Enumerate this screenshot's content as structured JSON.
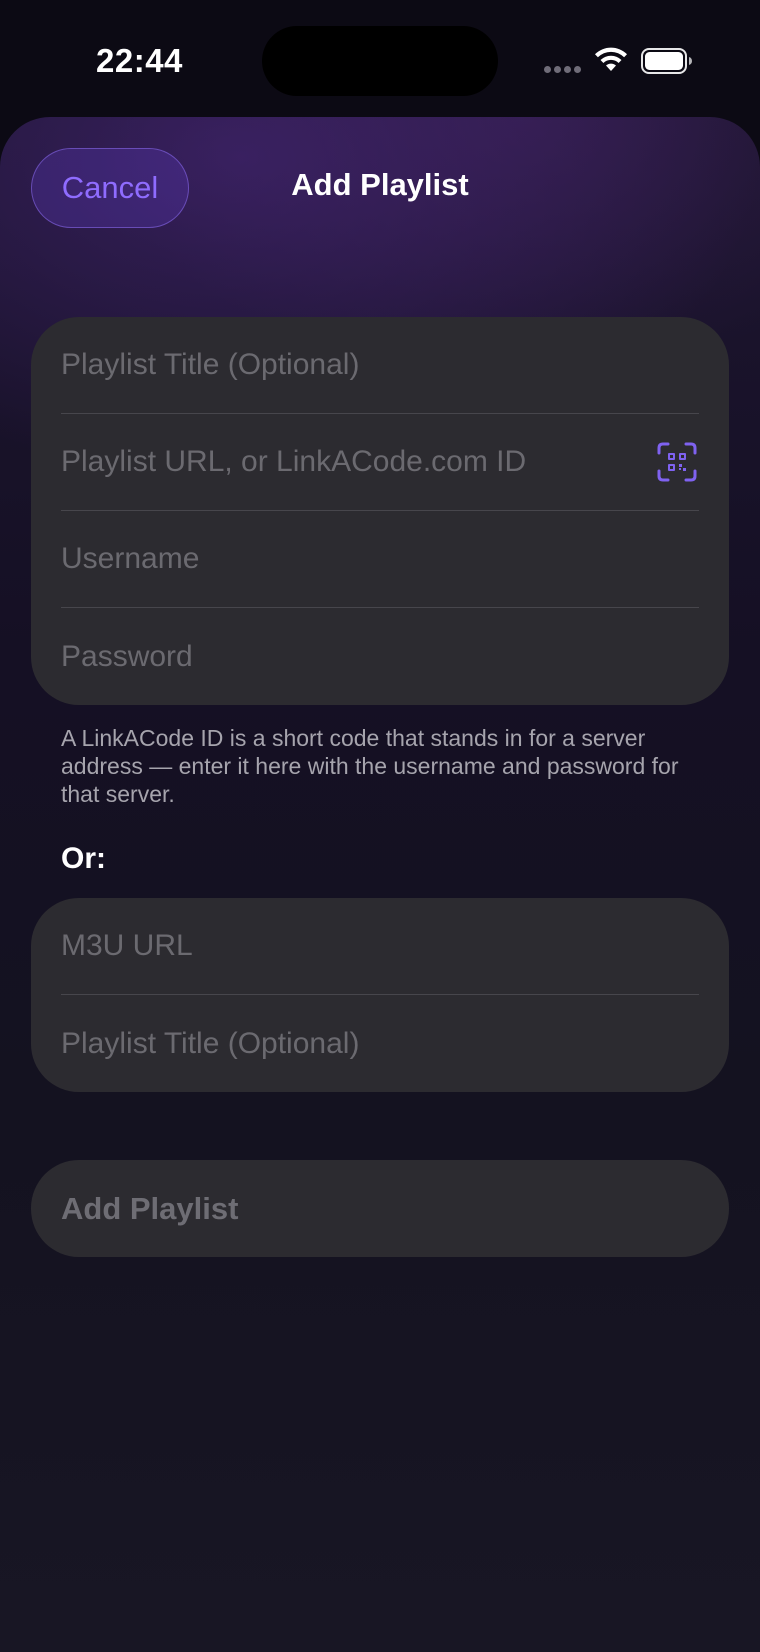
{
  "status_bar": {
    "time": "22:44"
  },
  "header": {
    "cancel_label": "Cancel",
    "title": "Add Playlist"
  },
  "xtream_form": {
    "title_placeholder": "Playlist Title (Optional)",
    "url_placeholder": "Playlist URL, or LinkACode.com ID",
    "username_placeholder": "Username",
    "password_placeholder": "Password",
    "qr_icon": "qr-scan-icon"
  },
  "hint": "A LinkACode ID is a short code that stands in for a server address — enter it here with the username and password for that server.",
  "or_label": "Or:",
  "m3u_form": {
    "url_placeholder": "M3U URL",
    "title_placeholder": "Playlist Title (Optional)"
  },
  "add_button_label": "Add Playlist",
  "colors": {
    "accent": "#8f6cff",
    "card": "#2c2b30",
    "placeholder": "#6b6a70"
  }
}
